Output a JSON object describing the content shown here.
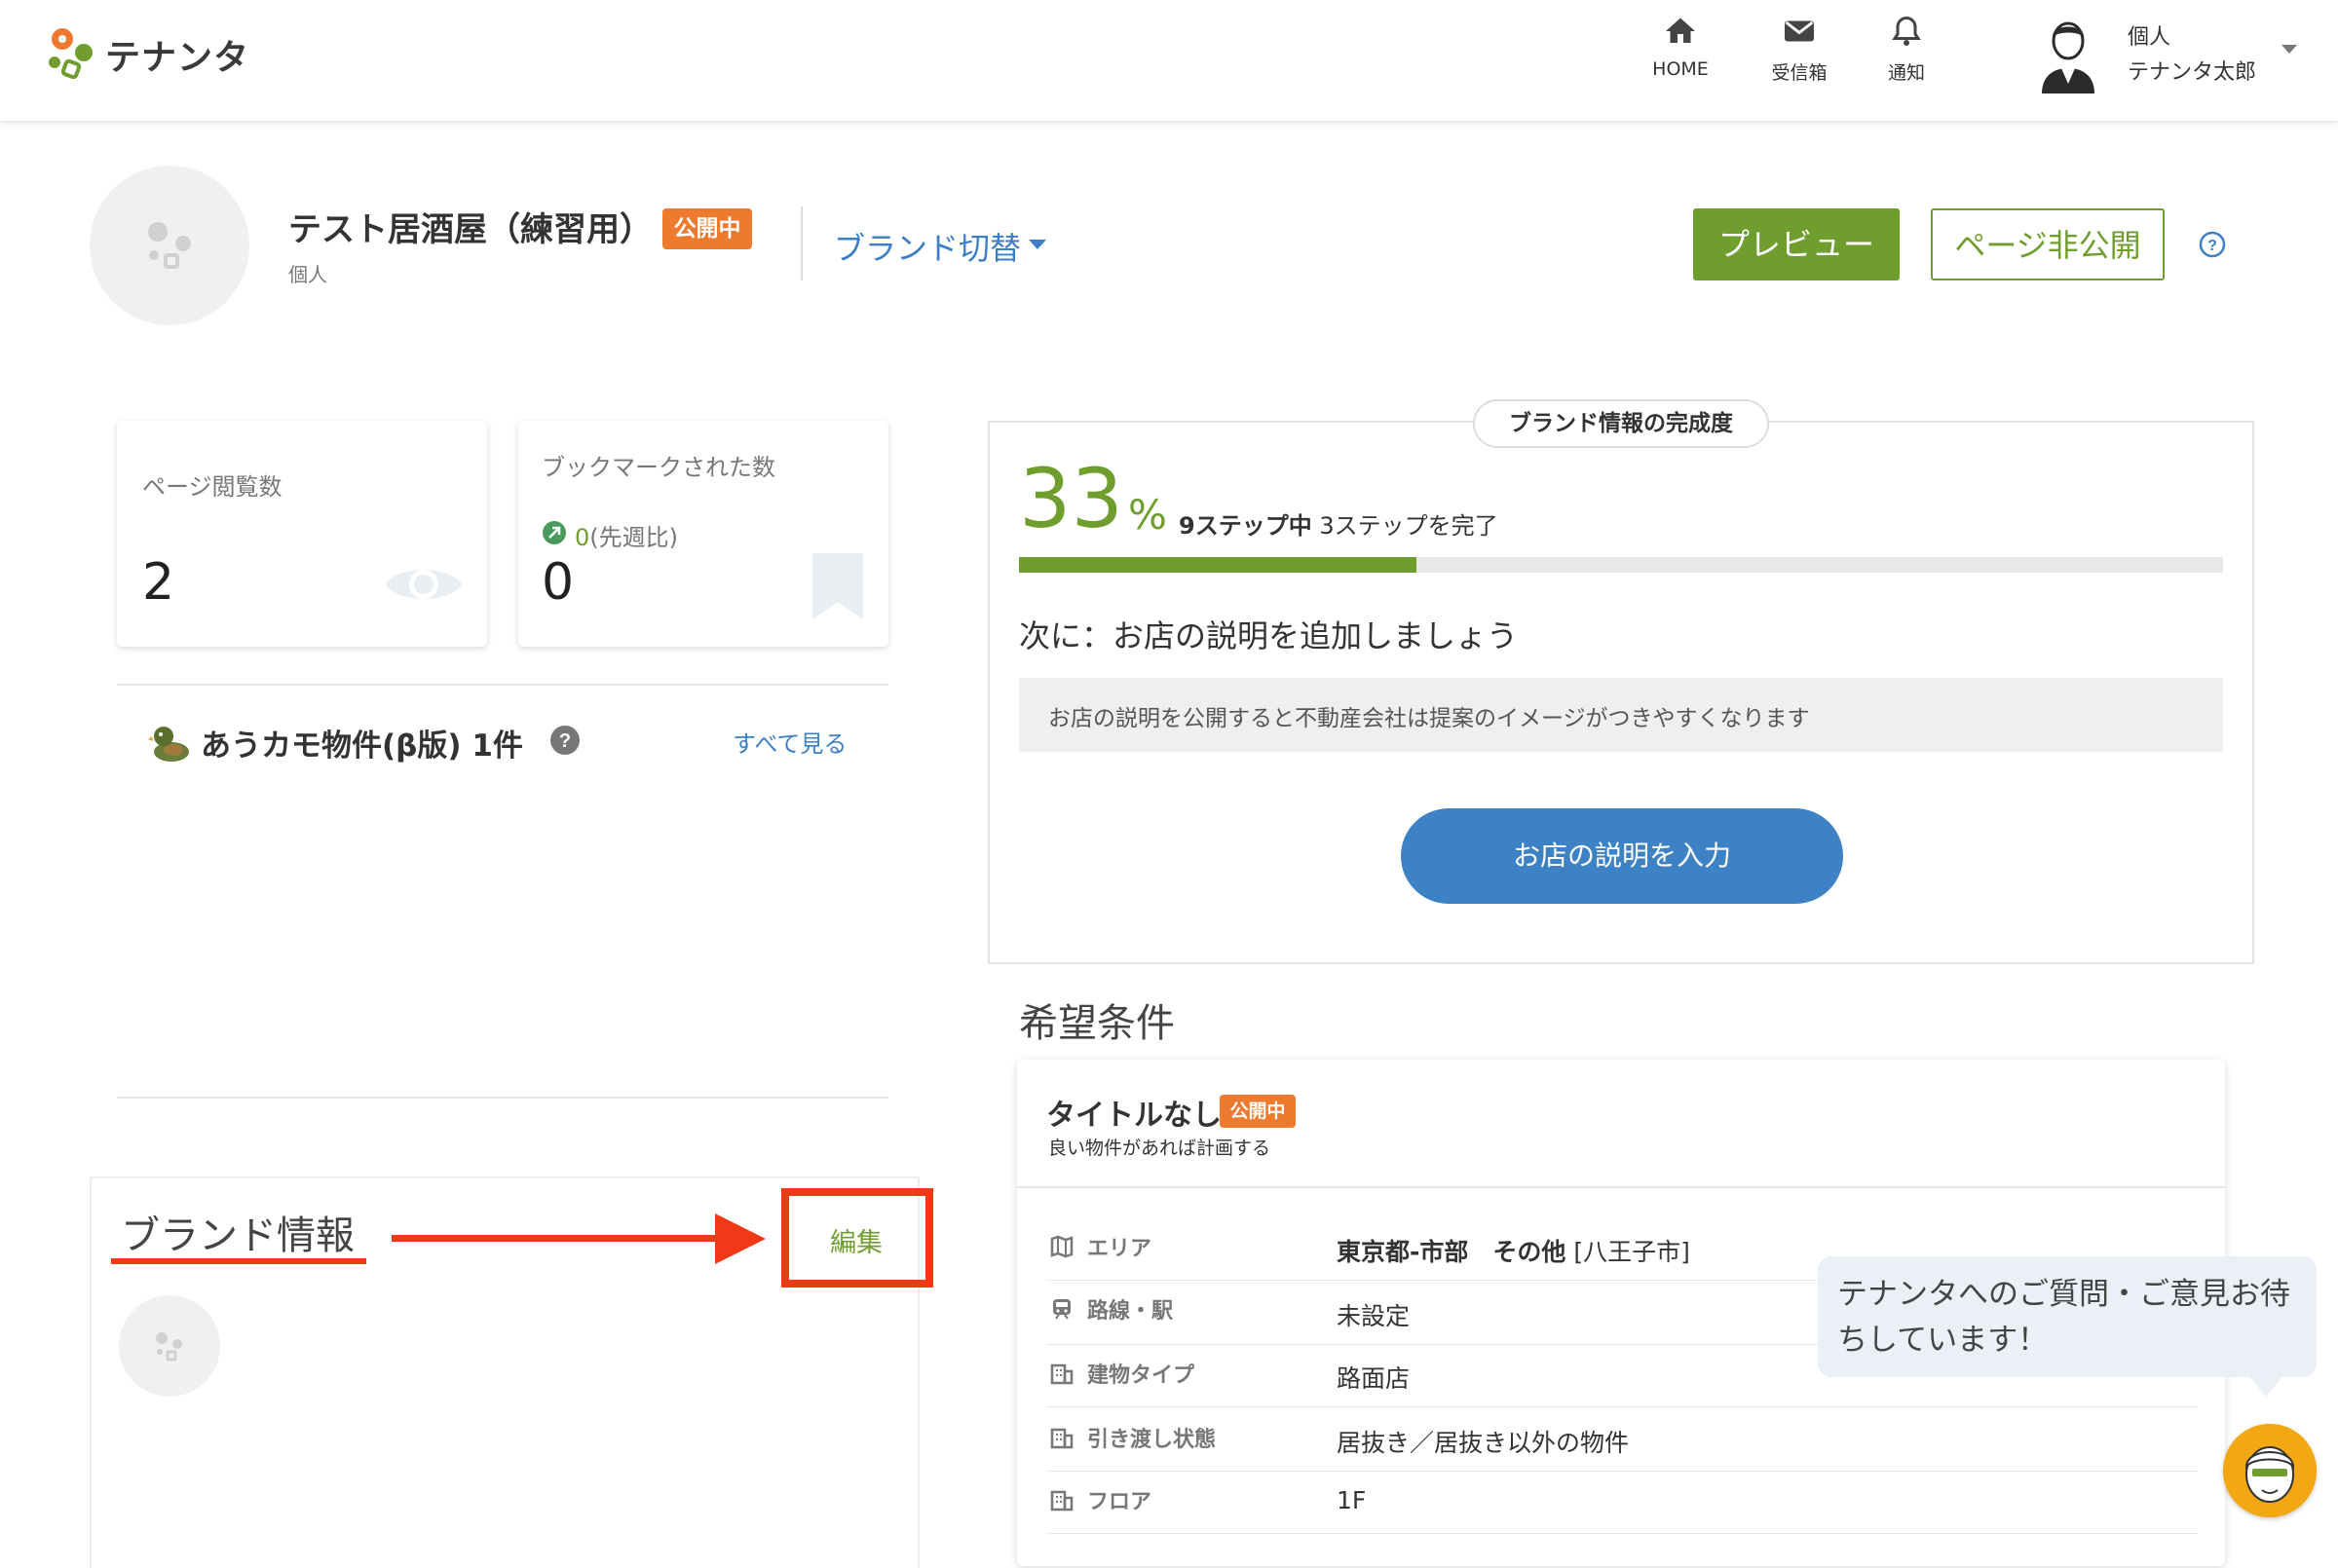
{
  "header": {
    "logo_text": "テナンタ",
    "nav": [
      {
        "label": "HOME",
        "icon": "home-icon"
      },
      {
        "label": "受信箱",
        "icon": "mail-icon"
      },
      {
        "label": "通知",
        "icon": "bell-icon"
      }
    ],
    "user": {
      "type": "個人",
      "name": "テナンタ太郎"
    }
  },
  "brand": {
    "name": "テスト居酒屋（練習用）",
    "status_badge": "公開中",
    "owner_type": "個人",
    "switch_label": "ブランド切替",
    "preview_button": "プレビュー",
    "unpublish_button": "ページ非公開"
  },
  "stats": {
    "page_views": {
      "label": "ページ閲覧数",
      "value": "2"
    },
    "bookmarks": {
      "label": "ブックマークされた数",
      "delta_value": "0",
      "delta_suffix": "(先週比)",
      "value": "0"
    }
  },
  "akamo": {
    "title": "あうカモ物件(β版) 1件",
    "see_all": "すべて見る"
  },
  "brand_info": {
    "title": "ブランド情報",
    "edit_link": "編集"
  },
  "completion": {
    "pill_label": "ブランド情報の完成度",
    "percent_value": 33,
    "percent": "33",
    "percent_sign": "%",
    "steps_total": "9ステップ中",
    "steps_done": "3ステップを完了",
    "next_step": "次に：お店の説明を追加しましょう",
    "hint": "お店の説明を公開すると不動産会社は提案のイメージがつきやすくなります",
    "cta_button": "お店の説明を入力"
  },
  "desired": {
    "section_title": "希望条件",
    "card_title": "タイトルなし",
    "card_badge": "公開中",
    "card_subtitle": "良い物件があれば計画する",
    "rows": [
      {
        "label": "エリア",
        "icon": "map-icon",
        "value_bold_1": "東京都-市部",
        "value_bold_2": "その他",
        "value": "[八王子市]"
      },
      {
        "label": "路線・駅",
        "icon": "train-icon",
        "value": "未設定"
      },
      {
        "label": "建物タイプ",
        "icon": "building-icon",
        "value": "路面店"
      },
      {
        "label": "引き渡し状態",
        "icon": "building-icon",
        "value": "居抜き／居抜き以外の物件"
      },
      {
        "label": "フロア",
        "icon": "building-icon",
        "value": "1F"
      }
    ]
  },
  "chat": {
    "message": "テナンタへのご質問・ご意見お待ちしています！"
  },
  "colors": {
    "accent_green": "#6f9e2f",
    "badge_orange": "#ed7a2f",
    "link_blue": "#3d7fc4",
    "annotation_red": "#f03a17"
  }
}
